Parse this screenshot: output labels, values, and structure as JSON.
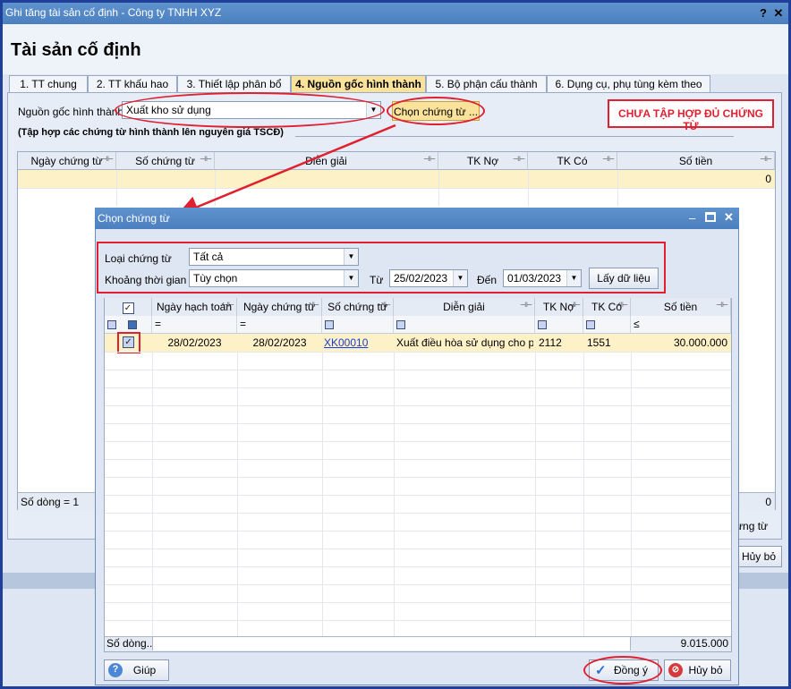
{
  "window": {
    "title": "Ghi tăng tài sản cố định - Công ty TNHH XYZ",
    "help": "?",
    "close": "✕"
  },
  "page_title": "Tài sản cố định",
  "tabs": [
    {
      "label": "1. TT chung"
    },
    {
      "label": "2. TT khấu hao"
    },
    {
      "label": "3. Thiết lập phân bổ"
    },
    {
      "label": "4. Nguồn gốc hình thành"
    },
    {
      "label": "5. Bộ phận cấu thành"
    },
    {
      "label": "6. Dụng cụ, phụ tùng kèm theo"
    }
  ],
  "source": {
    "label": "Nguồn gốc hình thành",
    "value": "Xuất kho sử dụng",
    "choose_button": "Chọn chứng từ ...",
    "warning": "CHƯA TẬP HỢP ĐỦ CHỨNG TỪ",
    "section_title": "(Tập hợp các chứng từ hình thành lên nguyên giá TSCĐ)"
  },
  "main_grid": {
    "columns": [
      "Ngày chứng từ",
      "Số chứng từ",
      "Diễn giải",
      "TK Nợ",
      "TK Có",
      "Số tiền"
    ],
    "row_amount": "0",
    "row_count": "Số dòng = 1",
    "footer_amount": "0"
  },
  "background_fragments": {
    "choose_doc_partial": "ừng từ",
    "cancel": "Hủy bỏ"
  },
  "dialog": {
    "title": "Chọn chứng từ",
    "filters": {
      "doc_type_label": "Loại chứng từ",
      "doc_type_value": "Tất cả",
      "period_label": "Khoảng thời gian",
      "period_value": "Tùy chọn",
      "from_label": "Từ",
      "from_value": "25/02/2023",
      "to_label": "Đến",
      "to_value": "01/03/2023",
      "fetch_button": "Lấy dữ liệu"
    },
    "columns": [
      "",
      "Ngày hạch toán",
      "Ngày chứng từ",
      "Số chứng từ",
      "Diễn giải",
      "TK Nợ",
      "TK Có",
      "Số tiền"
    ],
    "filter_ops": {
      "posting_date": "=",
      "doc_date": "=",
      "amount": "≤"
    },
    "rows": [
      {
        "checked": "✓",
        "posting_date": "28/02/2023",
        "doc_date": "28/02/2023",
        "doc_no": "XK00010",
        "description": "Xuất điều hòa sử dụng cho p...",
        "debit": "2112",
        "credit": "1551",
        "amount": "30.000.000"
      }
    ],
    "row_count": "Số dòng...",
    "total": "9.015.000",
    "help_button": "Giúp",
    "ok_button": "Đồng ý",
    "cancel_button": "Hủy bỏ"
  },
  "colors": {
    "title_bar": "#4c7fbf",
    "active_tab": "#fbe29a",
    "annotation": "#e02030",
    "highlight_row": "#fdf1c8"
  }
}
